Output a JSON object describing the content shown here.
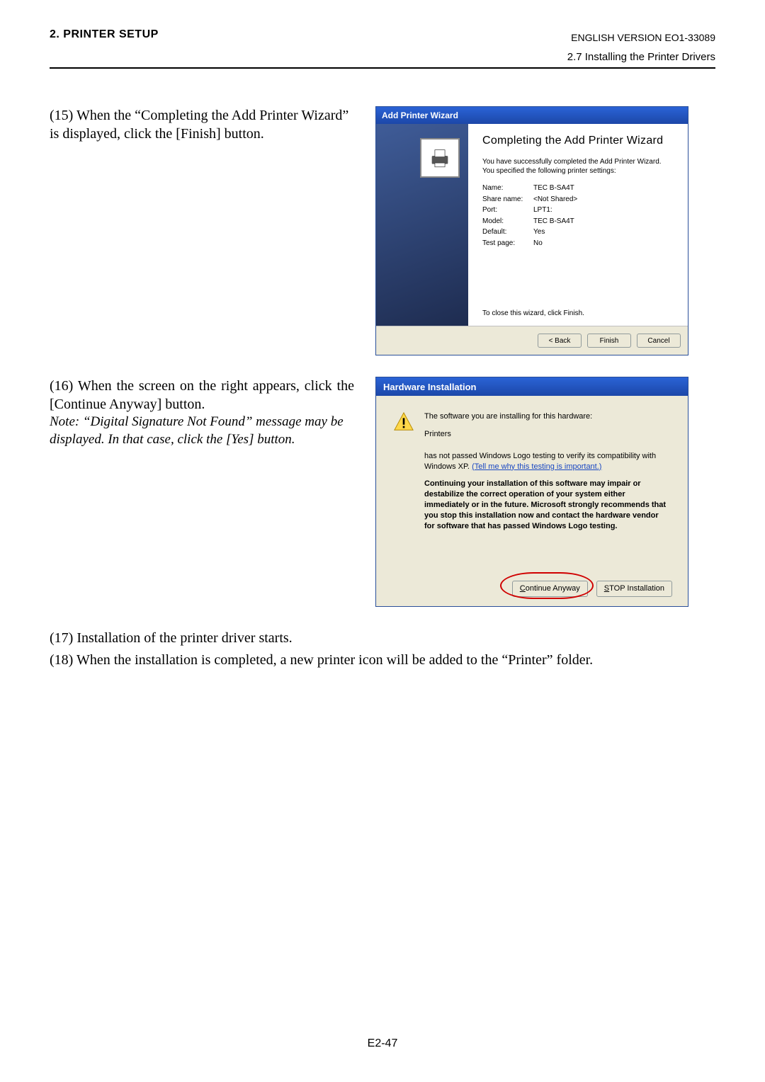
{
  "header": {
    "chapter": "2. PRINTER SETUP",
    "version": "ENGLISH VERSION EO1-33089",
    "section": "2.7 Installing the Printer Drivers"
  },
  "step15": {
    "text": "(15) When the “Completing the Add Printer Wizard” is displayed, click the [Finish] button."
  },
  "wizard": {
    "title": "Add Printer Wizard",
    "heading": "Completing the Add Printer Wizard",
    "lead1": "You have successfully completed the Add Printer Wizard.",
    "lead2": "You specified the following printer settings:",
    "props": [
      {
        "label": "Name:",
        "value": "TEC B-SA4T"
      },
      {
        "label": "Share name:",
        "value": "<Not Shared>"
      },
      {
        "label": "Port:",
        "value": "LPT1:"
      },
      {
        "label": "Model:",
        "value": "TEC B-SA4T"
      },
      {
        "label": "Default:",
        "value": "Yes"
      },
      {
        "label": "Test page:",
        "value": "No"
      }
    ],
    "close_text": "To close this wizard, click Finish.",
    "btn_back": "< Back",
    "btn_finish": "Finish",
    "btn_cancel": "Cancel"
  },
  "step16": {
    "text": "(16) When the screen on the right appears, click the [Continue Anyway] button.",
    "note": "Note:  “Digital Signature Not Found” message may be displayed.  In that case, click the [Yes] button."
  },
  "hwdlg": {
    "title": "Hardware Installation",
    "line1": "The software you are installing for this hardware:",
    "printers": "Printers",
    "logo1": "has not passed Windows Logo testing to verify its compatibility with Windows XP. ",
    "logo_link": "(Tell me why this testing is important.)",
    "bold_text": "Continuing your installation of this software may impair or destabilize the correct operation of your system either immediately or in the future. Microsoft strongly recommends that you stop this installation now and contact the hardware vendor for software that has passed Windows Logo testing.",
    "btn_continue": "Continue Anyway",
    "btn_stop": "STOP Installation"
  },
  "step17": "(17) Installation of the printer driver starts.",
  "step18": "(18) When the installation is completed, a new printer icon will be added to the “Printer” folder.",
  "page_number": "E2-47"
}
